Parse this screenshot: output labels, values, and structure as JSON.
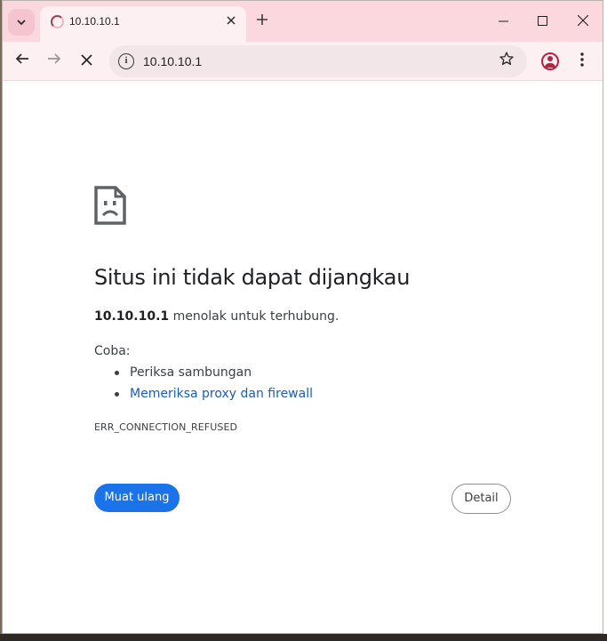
{
  "tab": {
    "title": "10.10.10.1",
    "close_icon": "close-icon"
  },
  "omnibox": {
    "url": "10.10.10.1"
  },
  "error": {
    "headline": "Situs ini tidak dapat dijangkau",
    "host": "10.10.10.1",
    "message": " menolak untuk terhubung.",
    "try_label": "Coba:",
    "suggestions": [
      "Periksa sambungan",
      "Memeriksa proxy dan firewall"
    ],
    "code": "ERR_CONNECTION_REFUSED"
  },
  "buttons": {
    "reload": "Muat ulang",
    "details": "Detail"
  },
  "colors": {
    "tab_strip": "#fbd7de",
    "toolbar": "#fdf0f2",
    "primary_button": "#1a73e8",
    "link": "#1a5fb4",
    "profile": "#b7223f"
  },
  "icons": {
    "tab_search": "chevron-down-icon",
    "new_tab": "plus-icon",
    "minimize": "minimize-icon",
    "maximize": "maximize-icon",
    "close": "close-icon",
    "back": "back-arrow-icon",
    "forward": "forward-arrow-icon",
    "stop": "stop-icon",
    "site_info": "info-icon",
    "bookmark": "star-icon",
    "profile": "profile-icon",
    "menu": "kebab-menu-icon",
    "page_error": "sad-document-icon"
  }
}
